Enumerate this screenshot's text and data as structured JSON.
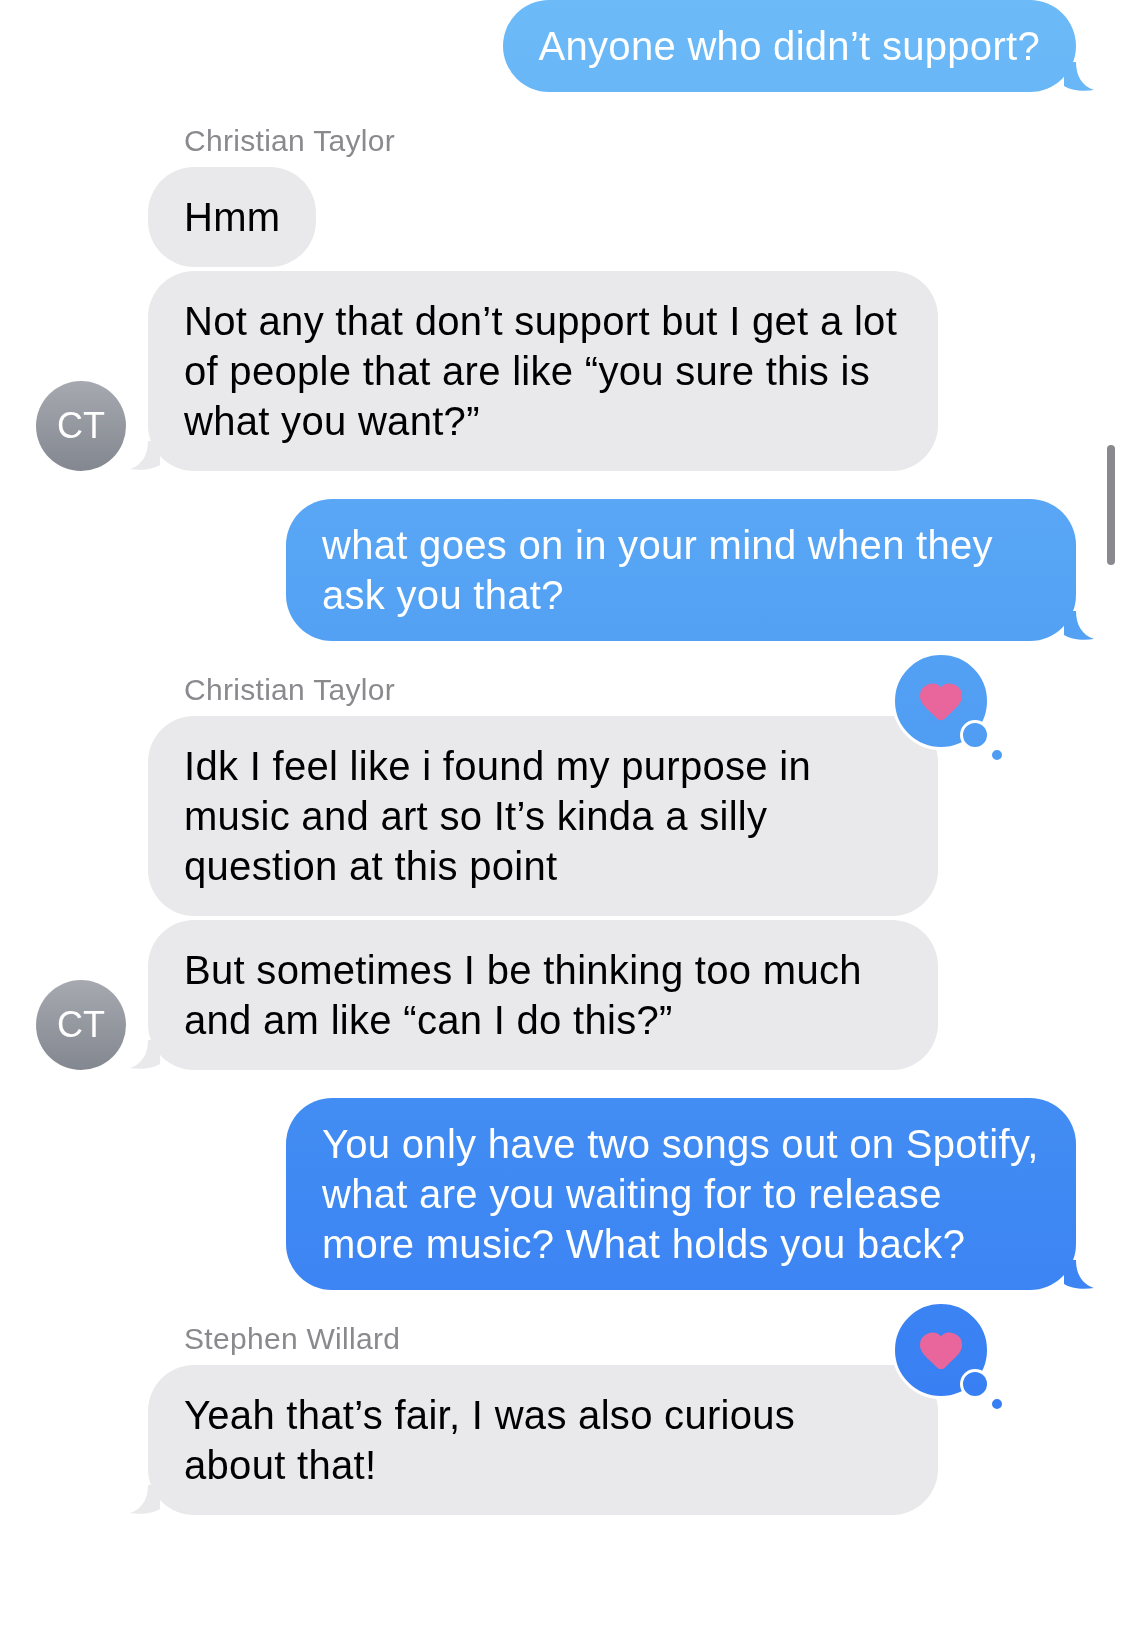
{
  "messages": [
    {
      "kind": "outgoing",
      "text": "Anyone who didn’t support?"
    },
    {
      "kind": "incoming",
      "sender": "Christian Taylor",
      "avatar": "CT",
      "bubbles": [
        {
          "text": "Hmm",
          "reacted": false
        },
        {
          "text": "Not any that don’t support but I get a lot of people that are like “you sure this is what you want?”",
          "reacted": false
        }
      ]
    },
    {
      "kind": "outgoing",
      "text": "what goes on in your mind when they ask you that?"
    },
    {
      "kind": "incoming",
      "sender": "Christian Taylor",
      "avatar": "CT",
      "bubbles": [
        {
          "text": "Idk I feel like i found my purpose in music and art so It’s kinda a silly question at this point",
          "reacted": true
        },
        {
          "text": "But sometimes I be thinking too much and am like “can I do this?”",
          "reacted": false
        }
      ]
    },
    {
      "kind": "outgoing",
      "text": "You only have two songs out on Spotify, what are you waiting for to release more music? What holds you back?"
    },
    {
      "kind": "incoming",
      "sender": "Stephen Willard",
      "bubbles": [
        {
          "text": "Yeah that’s fair, I was also curious about that!",
          "reacted": true
        }
      ]
    }
  ]
}
